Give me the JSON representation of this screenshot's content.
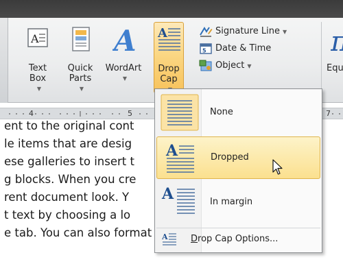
{
  "ribbon": {
    "text_box": {
      "line1": "Text",
      "line2": "Box"
    },
    "quick_parts": {
      "line1": "Quick",
      "line2": "Parts"
    },
    "wordart": {
      "line1": "WordArt"
    },
    "drop_cap": {
      "line1": "Drop",
      "line2": "Cap"
    },
    "signature_line": "Signature Line",
    "date_time": "Date & Time",
    "object": "Object",
    "equation_partial": "Equ"
  },
  "ruler": {
    "marks": [
      "4",
      "5",
      "7"
    ]
  },
  "document": {
    "lines": [
      "ent to the original cont",
      "le items that are desig",
      "ese galleries to insert t",
      "g blocks. When you cre",
      "rent document look. Y",
      "t text by choosing a lo",
      "e tab. You can also format text directly"
    ]
  },
  "drop_cap_menu": {
    "items": [
      {
        "label": "None",
        "selected": false
      },
      {
        "label": "Dropped",
        "selected": true
      },
      {
        "label": "In margin",
        "selected": false
      }
    ],
    "options_label": "Drop Cap Options..."
  },
  "colors": {
    "highlight": "#fbd784",
    "highlight_border": "#e0b44c",
    "ribbon_bg": "#ecedee",
    "icon_blue": "#2e6fb7"
  }
}
